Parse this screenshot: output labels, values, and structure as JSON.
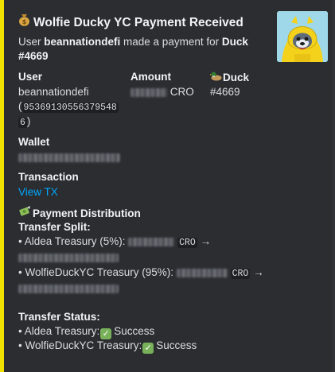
{
  "embed": {
    "accent_color": "#f0e100",
    "title_emoji": "money-bag-icon",
    "title": "Wolfie Ducky YC Payment Received",
    "description": {
      "prefix": "User ",
      "user": "beannationdefi",
      "middle": " made a payment for ",
      "duck": "Duck #4669"
    },
    "fields": {
      "user": {
        "label": "User",
        "name": "beannationdefi",
        "id_line1": "953691305563795",
        "id_line2": "48",
        "id_line3": "6"
      },
      "amount": {
        "label": "Amount",
        "currency": "CRO"
      },
      "duck": {
        "label": "Duck",
        "value": "#4669"
      },
      "wallet": {
        "label": "Wallet"
      },
      "transaction": {
        "label": "Transaction",
        "link": "View TX"
      }
    },
    "distribution": {
      "heading": "Payment Distribution",
      "split_label": "Transfer Split:",
      "split": [
        {
          "name": "• Aldea Treasury (5%):",
          "currency": "CRO",
          "arrow": "→"
        },
        {
          "name": "• WolfieDuckYC Treasury (95%):",
          "currency": "CRO",
          "arrow": "→"
        }
      ],
      "status_label": "Transfer Status:",
      "status": [
        {
          "name": "• Aldea Treasury:",
          "result": "Success"
        },
        {
          "name": "• WolfieDuckYC Treasury:",
          "result": "Success"
        }
      ]
    }
  }
}
